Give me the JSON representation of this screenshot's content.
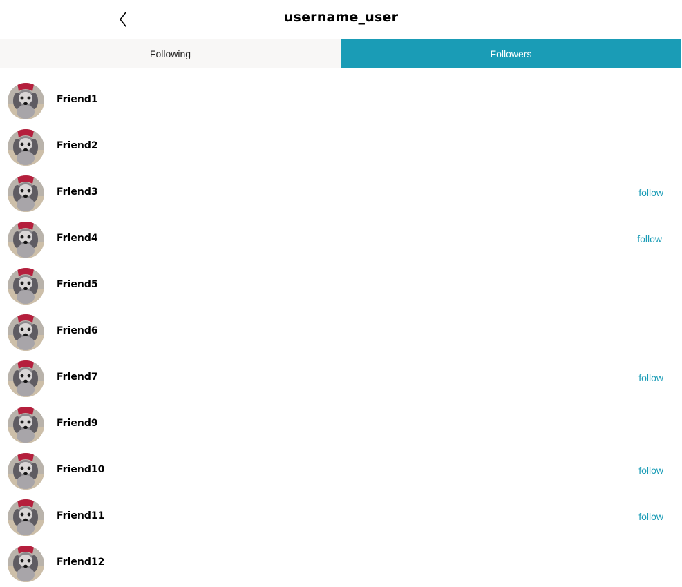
{
  "header": {
    "title": "username_user",
    "back_icon": "chevron-left-icon"
  },
  "tabs": [
    {
      "label": "Following",
      "active": false
    },
    {
      "label": "Followers",
      "active": true
    }
  ],
  "colors": {
    "accent": "#1a9cb6",
    "tab_inactive_bg": "#f8f7f6"
  },
  "followers": [
    {
      "name": "Friend1",
      "action": ""
    },
    {
      "name": "Friend2",
      "action": ""
    },
    {
      "name": "Friend3",
      "action": "follow"
    },
    {
      "name": "Friend4",
      "action": "follow"
    },
    {
      "name": "Friend5",
      "action": ""
    },
    {
      "name": "Friend6",
      "action": ""
    },
    {
      "name": "Friend7",
      "action": "follow"
    },
    {
      "name": "Friend9",
      "action": ""
    },
    {
      "name": "Friend10",
      "action": "follow"
    },
    {
      "name": "Friend11",
      "action": "follow"
    },
    {
      "name": "Friend12",
      "action": ""
    }
  ]
}
